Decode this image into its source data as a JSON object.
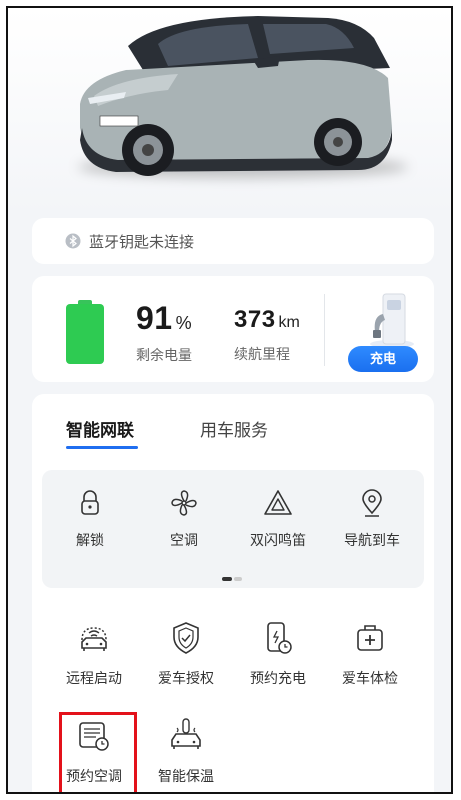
{
  "bluetooth": {
    "status_text": "蓝牙钥匙未连接",
    "icon": "bluetooth-icon"
  },
  "battery": {
    "level_value": "91",
    "level_unit": "%",
    "level_label": "剩余电量",
    "range_value": "373",
    "range_unit": "km",
    "range_label": "续航里程",
    "charge_button": "充电",
    "fill_fraction": 0.91,
    "color": "#2ecb52"
  },
  "tabs": [
    {
      "label": "智能网联",
      "active": true
    },
    {
      "label": "用车服务",
      "active": false
    }
  ],
  "quick_controls": [
    {
      "label": "解锁",
      "icon": "unlock-icon"
    },
    {
      "label": "空调",
      "icon": "fan-icon"
    },
    {
      "label": "双闪鸣笛",
      "icon": "hazard-triangle-icon"
    },
    {
      "label": "导航到车",
      "icon": "location-pin-icon"
    }
  ],
  "services": [
    {
      "label": "远程启动",
      "icon": "remote-start-icon"
    },
    {
      "label": "爱车授权",
      "icon": "shield-check-icon"
    },
    {
      "label": "预约充电",
      "icon": "scheduled-charging-icon"
    },
    {
      "label": "爱车体检",
      "icon": "car-checkup-icon"
    },
    {
      "label": "预约空调",
      "icon": "scheduled-ac-icon"
    },
    {
      "label": "智能保温",
      "icon": "smart-insulation-icon"
    }
  ],
  "colors": {
    "accent": "#1f6ef0",
    "highlight": "#e3111a"
  }
}
